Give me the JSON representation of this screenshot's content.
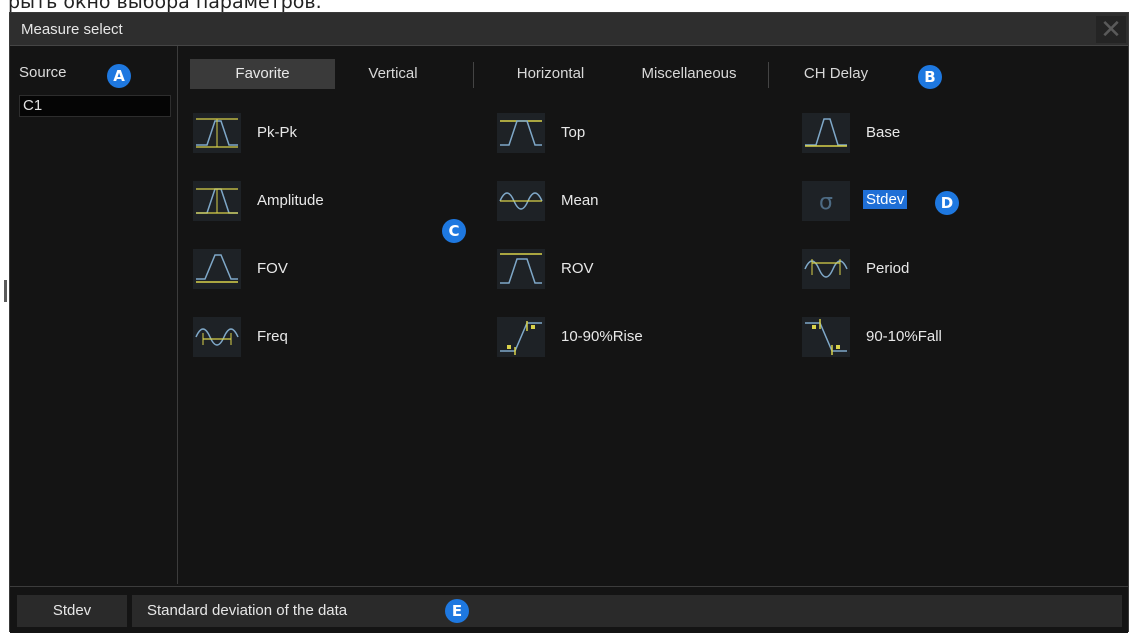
{
  "caption": "рыть окно выбора параметров.",
  "window": {
    "title": "Measure select",
    "close_glyph": "✕"
  },
  "source": {
    "label": "Source",
    "items": [
      "C1"
    ]
  },
  "tabs": [
    {
      "label": "Favorite",
      "active": true
    },
    {
      "label": "Vertical",
      "active": false
    },
    {
      "label": "Horizontal",
      "active": false
    },
    {
      "label": "Miscellaneous",
      "active": false
    },
    {
      "label": "CH Delay",
      "active": false
    }
  ],
  "measurements": [
    {
      "label": "Pk-Pk",
      "icon": "pk-pk-icon"
    },
    {
      "label": "Top",
      "icon": "top-icon"
    },
    {
      "label": "Base",
      "icon": "base-icon"
    },
    {
      "label": "Amplitude",
      "icon": "amplitude-icon"
    },
    {
      "label": "Mean",
      "icon": "mean-icon"
    },
    {
      "label": "Stdev",
      "icon": "stdev-icon",
      "selected": true
    },
    {
      "label": "FOV",
      "icon": "fov-icon"
    },
    {
      "label": "ROV",
      "icon": "rov-icon"
    },
    {
      "label": "Period",
      "icon": "period-icon"
    },
    {
      "label": "Freq",
      "icon": "freq-icon"
    },
    {
      "label": "10-90%Rise",
      "icon": "rise-icon"
    },
    {
      "label": "90-10%Fall",
      "icon": "fall-icon"
    }
  ],
  "status": {
    "name": "Stdev",
    "description": "Standard deviation of the data"
  },
  "badges": {
    "a": "A",
    "b": "B",
    "c": "C",
    "d": "D",
    "e": "E"
  },
  "colors": {
    "accent": "#1f6fd6",
    "badge": "#1e78e0",
    "waveform": "#7fa8c8",
    "marker": "#d9d24a"
  }
}
